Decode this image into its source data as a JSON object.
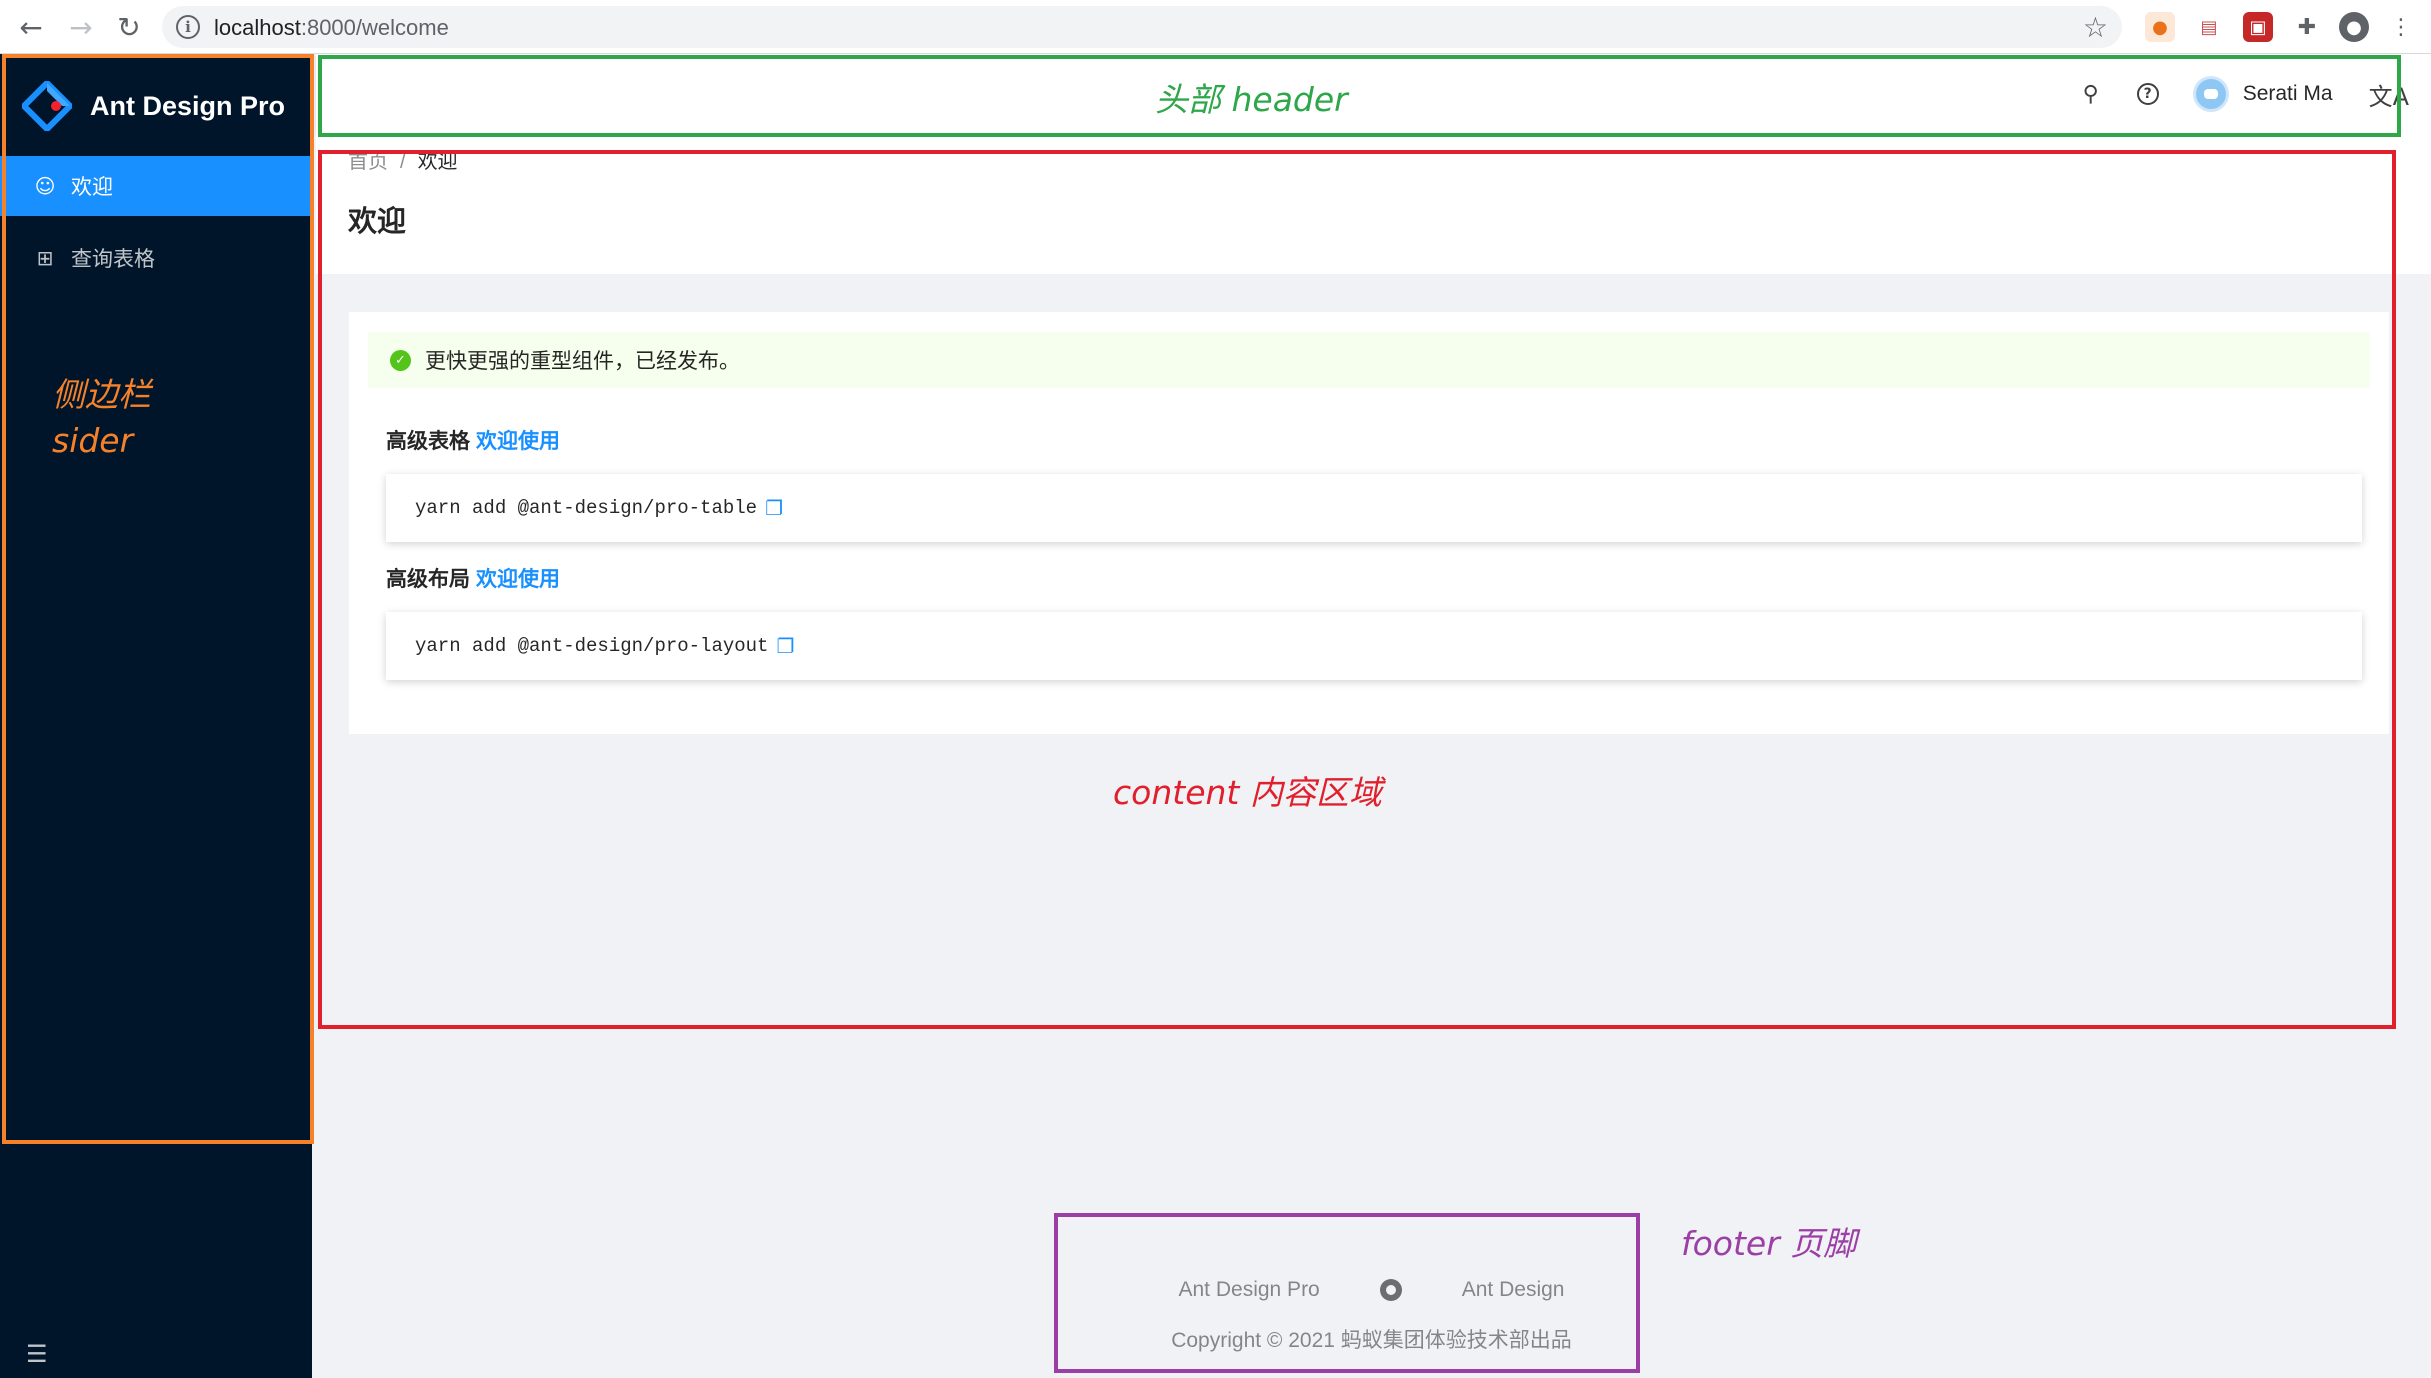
{
  "browser": {
    "url_host": "localhost",
    "url_path": ":8000/welcome",
    "back_icon": "arrow-left-icon",
    "forward_icon": "arrow-right-icon",
    "reload_icon": "reload-icon",
    "bookmark_icon": "star-icon"
  },
  "sider": {
    "logo_text": "Ant Design Pro",
    "menu": [
      {
        "label": "欢迎",
        "icon": "smile-icon",
        "active": true
      },
      {
        "label": "查询表格",
        "icon": "table-icon",
        "active": false
      }
    ],
    "collapse_icon": "menu-fold-icon",
    "bg_color": "#001529",
    "active_color": "#1890ff"
  },
  "header": {
    "user_name": "Serati Ma",
    "icons": [
      "search-icon",
      "question-icon",
      "avatar",
      "translation-icon"
    ]
  },
  "page": {
    "breadcrumb": [
      "首页",
      "欢迎"
    ],
    "breadcrumb_separator": "/",
    "title": "欢迎"
  },
  "content": {
    "alert": "更快更强的重型组件，已经发布。",
    "sections": [
      {
        "title": "高级表格",
        "link": "欢迎使用",
        "code": "yarn add @ant-design/pro-table"
      },
      {
        "title": "高级布局",
        "link": "欢迎使用",
        "code": "yarn add @ant-design/pro-layout"
      }
    ]
  },
  "footer": {
    "links": [
      "Ant Design Pro",
      "Ant Design"
    ],
    "copyright": "Copyright © 2021 蚂蚁集团体验技术部出品"
  },
  "annotations": {
    "header_label": "头部 header",
    "sider_label_1": "侧边栏",
    "sider_label_2": "sider",
    "content_label": "content  内容区域",
    "footer_label": "footer  页脚",
    "colors": {
      "header": "#2ea64a",
      "sider": "#f5822a",
      "content": "#e0202c",
      "footer": "#9b3fa6"
    }
  }
}
